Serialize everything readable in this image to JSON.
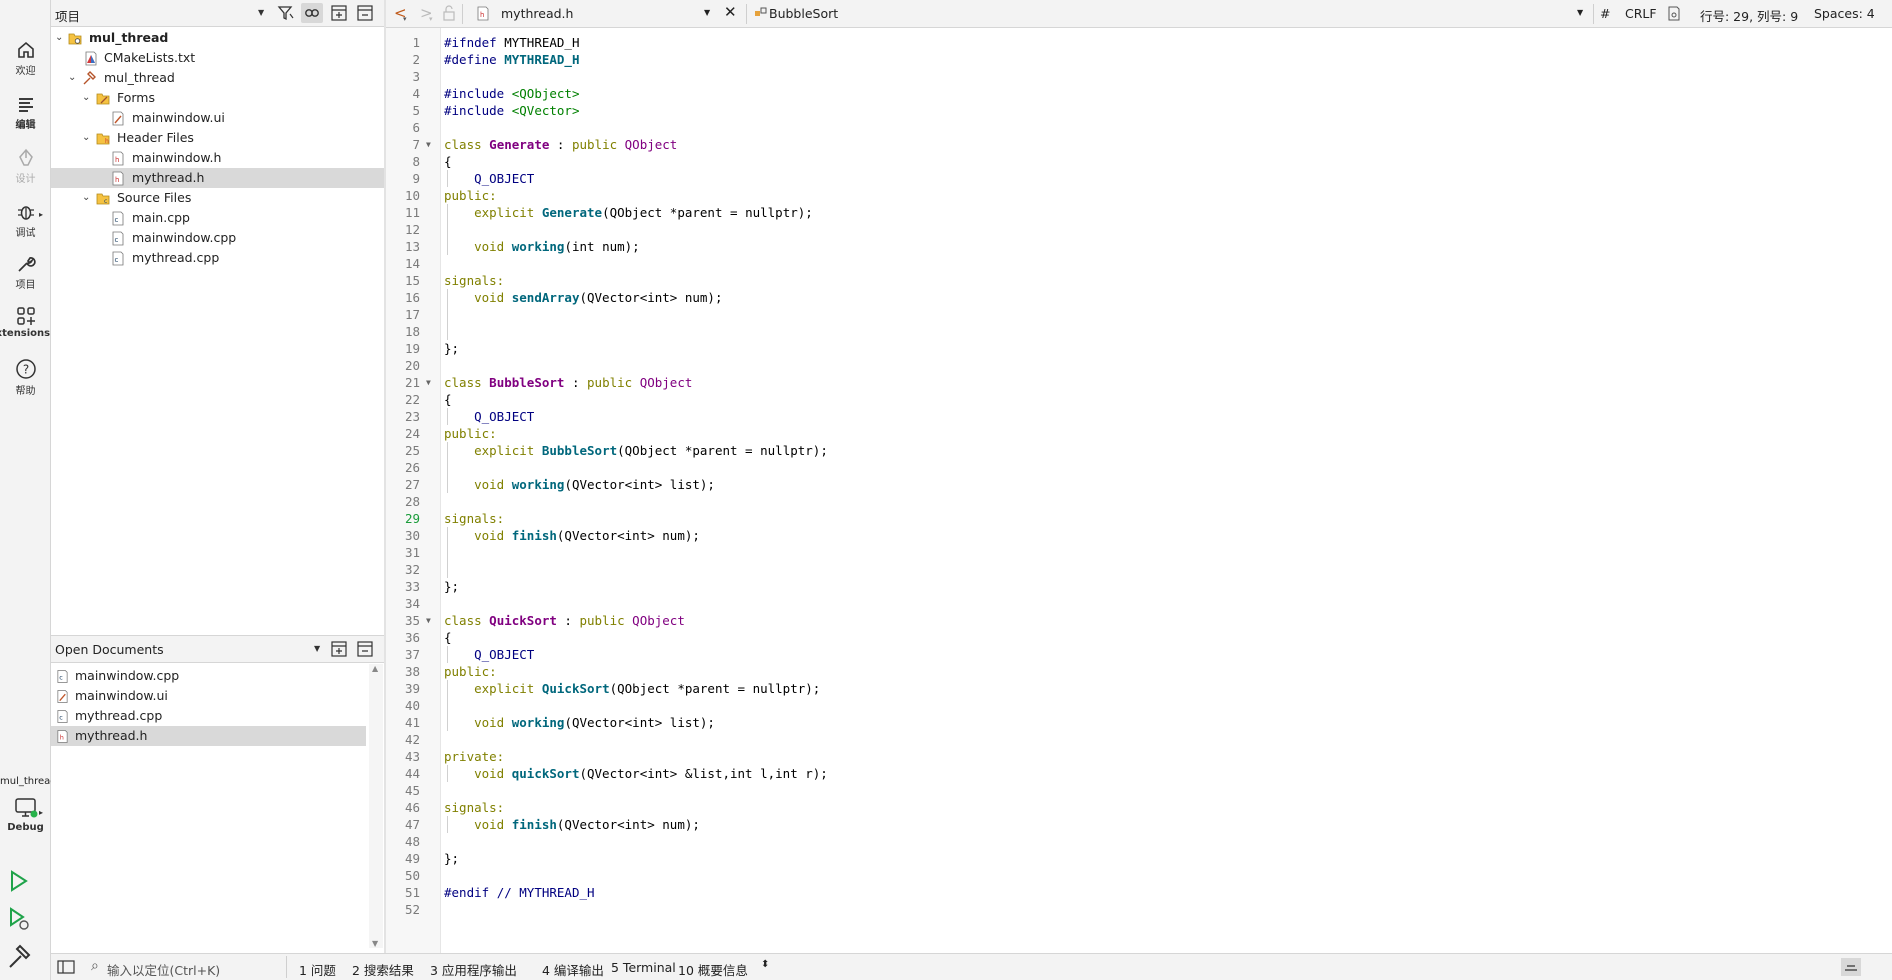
{
  "modebar": {
    "welcome": "欢迎",
    "edit": "编辑",
    "design": "设计",
    "debug": "调试",
    "projects": "项目",
    "extensions": "Extensions",
    "help": "帮助",
    "target_project": "mul_thread",
    "target_config": "Debug"
  },
  "project_panel": {
    "title": "项目",
    "items": [
      {
        "label": "mul_thread",
        "type": "project"
      },
      {
        "label": "CMakeLists.txt",
        "type": "cmake"
      },
      {
        "label": "mul_thread",
        "type": "target"
      },
      {
        "label": "Forms",
        "type": "folder"
      },
      {
        "label": "mainwindow.ui",
        "type": "ui"
      },
      {
        "label": "Header Files",
        "type": "folder"
      },
      {
        "label": "mainwindow.h",
        "type": "header"
      },
      {
        "label": "mythread.h",
        "type": "header"
      },
      {
        "label": "Source Files",
        "type": "folder"
      },
      {
        "label": "main.cpp",
        "type": "source"
      },
      {
        "label": "mainwindow.cpp",
        "type": "source"
      },
      {
        "label": "mythread.cpp",
        "type": "source"
      }
    ]
  },
  "open_documents": {
    "title": "Open Documents",
    "items": [
      "mainwindow.cpp",
      "mainwindow.ui",
      "mythread.cpp",
      "mythread.h"
    ]
  },
  "editor_toolbar": {
    "file": "mythread.h",
    "symbol": "BubbleSort",
    "hash": "#",
    "line_ending": "CRLF",
    "position": "行号: 29, 列号: 9",
    "indent": "Spaces: 4"
  },
  "editor": {
    "current_line": 29,
    "lines": [
      "1",
      "2",
      "3",
      "4",
      "5",
      "6",
      "7",
      "8",
      "9",
      "10",
      "11",
      "12",
      "13",
      "14",
      "15",
      "16",
      "17",
      "18",
      "19",
      "20",
      "21",
      "22",
      "23",
      "24",
      "25",
      "26",
      "27",
      "28",
      "29",
      "30",
      "31",
      "32",
      "33",
      "34",
      "35",
      "36",
      "37",
      "38",
      "39",
      "40",
      "41",
      "42",
      "43",
      "44",
      "45",
      "46",
      "47",
      "48",
      "49",
      "50",
      "51",
      "52"
    ],
    "code": {
      "l1_kw": "#ifndef",
      "l1_rest": " MYTHREAD_H",
      "l2_kw": "#define",
      "l2_rest": "MYTHREAD_H",
      "l4_kw": "#include",
      "l4_rest": "<QObject>",
      "l5_kw": "#include",
      "l5_rest": "<QVector>",
      "class": "class",
      "public": "public",
      "qobject": "QObject",
      "generate": "Generate",
      "bubblesort": "BubbleSort",
      "quicksort": "QuickSort",
      "lbrace": "{",
      "rbrace_semi": "};",
      "q_object": "Q_OBJECT",
      "public_colon": "public:",
      "signals_colon": "signals:",
      "private_colon": "private:",
      "explicit": "explicit",
      "ctor_args": "(QObject *parent = nullptr);",
      "void": "void",
      "working": "working",
      "send_array": "sendArray",
      "finish": "finish",
      "quick_sort": "quickSort",
      "l13_args": "(int num);",
      "l16_args": "(QVector<int> num);",
      "list_args": "(QVector<int> list);",
      "l44_args": "(QVector<int> &list,int l,int r);",
      "l51_kw": "#endif",
      "l51_cm": "// MYTHREAD_H"
    }
  },
  "statusbar": {
    "locator_placeholder": "输入以定位(Ctrl+K)",
    "tabs": [
      "1 问题",
      "2 搜索结果",
      "3 应用程序输出",
      "4 编译输出",
      "5 Terminal",
      "10 概要信息"
    ]
  }
}
